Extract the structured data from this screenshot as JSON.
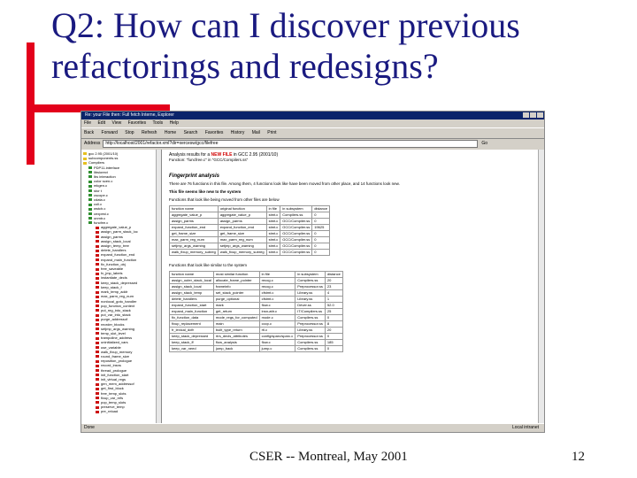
{
  "slide": {
    "title": "Q2: How can I discover previous refactorings and redesigns?",
    "footer_center": "CSER -- Montreal, May 2001",
    "page_number": "12",
    "accent_color": "#e3001b",
    "title_color": "#1a1a80"
  },
  "browser": {
    "window_title": "Re: your File then: Full fetch Interne, Explorer",
    "menu": [
      "File",
      "Edit",
      "View",
      "Favorites",
      "Tools",
      "Help"
    ],
    "toolbar": [
      "Back",
      "Forward",
      "Stop",
      "Refresh",
      "Home",
      "Search",
      "Favorites",
      "History",
      "Mail",
      "Print"
    ],
    "address_label": "Address",
    "address_value": "http://localhost/2001/refactor.xml?dir=xercesw/gcc/filefree",
    "go_label": "Go",
    "status_left": "Done",
    "status_right": "Local intranet"
  },
  "tree": {
    "items": [
      {
        "label": "gcc 2.95 (2001/10)",
        "color": "y"
      },
      {
        "label": "subcomponents.ss",
        "color": "y"
      },
      {
        "label": "Compilers",
        "color": "y"
      },
      {
        "label": "PDP11-interface",
        "color": "g"
      },
      {
        "label": "libsiorect",
        "color": "g"
      },
      {
        "label": "lbs interaction",
        "color": "g"
      },
      {
        "label": "color scen.c",
        "color": "g"
      },
      {
        "label": "mkgen.c",
        "color": "g"
      },
      {
        "label": "stor t",
        "color": "g"
      },
      {
        "label": "cscope.c",
        "color": "g"
      },
      {
        "label": "cdata.c",
        "color": "g"
      },
      {
        "label": "coll.c",
        "color": "g"
      },
      {
        "label": "wstch.c",
        "color": "g"
      },
      {
        "label": "cexpest.c",
        "color": "g"
      },
      {
        "label": "onmtr.c",
        "color": "g"
      },
      {
        "label": "funcfee.c",
        "color": "g"
      },
      {
        "label": "aggregate_value_p",
        "color": "r"
      },
      {
        "label": "assign_parm_stack_loc",
        "color": "r"
      },
      {
        "label": "assign_parms",
        "color": "r"
      },
      {
        "label": "assign_stack_local",
        "color": "r"
      },
      {
        "label": "assign_temp_tree",
        "color": "r"
      },
      {
        "label": "delete_handlers",
        "color": "r"
      },
      {
        "label": "expand_function_end",
        "color": "r"
      },
      {
        "label": "expand_main_function",
        "color": "r"
      },
      {
        "label": "fix_function_obj",
        "color": "r"
      },
      {
        "label": "free_saveable",
        "color": "r"
      },
      {
        "label": "fx_jmp_labels",
        "color": "r"
      },
      {
        "label": "instantiate_decls",
        "color": "r"
      },
      {
        "label": "keep_stack_depressed",
        "color": "r"
      },
      {
        "label": "keep_stack_f",
        "color": "r"
      },
      {
        "label": "mark_temp_addr",
        "color": "r"
      },
      {
        "label": "max_parm_reg_num",
        "color": "r"
      },
      {
        "label": "nonlocal_goto_handler",
        "color": "r"
      },
      {
        "label": "pop_function_context",
        "color": "r"
      },
      {
        "label": "put_reg_into_stack",
        "color": "r"
      },
      {
        "label": "put_var_into_stack",
        "color": "r"
      },
      {
        "label": "purge_addressof",
        "color": "r"
      },
      {
        "label": "reorder_blocks",
        "color": "r"
      },
      {
        "label": "setjmp_args_warning",
        "color": "r"
      },
      {
        "label": "temp_slot_level",
        "color": "r"
      },
      {
        "label": "trampoline_address",
        "color": "r"
      },
      {
        "label": "uninitialized_vars",
        "color": "r"
      },
      {
        "label": "use_variable",
        "color": "r"
      },
      {
        "label": "walk_fixup_memory",
        "color": "r"
      },
      {
        "label": "round_frame_size",
        "color": "r"
      },
      {
        "label": "reposition_prologue",
        "color": "r"
      },
      {
        "label": "record_insns",
        "color": "r"
      },
      {
        "label": "thread_prologue",
        "color": "r"
      },
      {
        "label": "init_function_start",
        "color": "r"
      },
      {
        "label": "init_virtual_regs",
        "color": "r"
      },
      {
        "label": "gen_mem_addressof",
        "color": "r"
      },
      {
        "label": "get_first_block",
        "color": "r"
      },
      {
        "label": "free_temp_slots",
        "color": "r"
      },
      {
        "label": "fixup_var_refs",
        "color": "r"
      },
      {
        "label": "pop_temp_slots",
        "color": "r"
      },
      {
        "label": "preserve_temp",
        "color": "r"
      },
      {
        "label": "pre_reload",
        "color": "r"
      }
    ]
  },
  "page": {
    "heading_prefix": "Analysis results for a ",
    "heading_highlight": "NEW FILE",
    "heading_suffix": " in GCC 2.95 (2001/10)",
    "subheading": "Function: \"funcfree.c\" in \"GCC/Compilers.ss\"",
    "analysis_title": "Fingerprint analysis",
    "desc_line": "There are 76 functions in this file. Among them, 4 functions look like have been moved from other place, and 14 functions look new.",
    "new_functions_title": "This file seems like new to the system",
    "moved_intro": "Functions that look like being moved from other files are below",
    "table1": {
      "headers": [
        "function name",
        "original function",
        "in file",
        "in subsystem",
        "distance"
      ],
      "rows": [
        [
          "aggregate_value_p",
          "aggregate_value_p",
          "stmt.c",
          "Compilers.ss",
          "0"
        ],
        [
          "assign_parms",
          "assign_parms",
          "stmt.c",
          "GCC/Compiler.ss",
          "0"
        ],
        [
          "expand_function_end",
          "expand_function_end",
          "stmt.c",
          "GCC/Compiler.ss",
          "19625"
        ],
        [
          "get_frame_size",
          "get_frame_size",
          "stmt.c",
          "GCC/Compiler.ss",
          "0"
        ],
        [
          "max_parm_reg_num",
          "max_parm_reg_num",
          "stmt.c",
          "GCC/Compiler.ss",
          "0"
        ],
        [
          "setjmp_args_warning",
          "setjmp_args_warning",
          "stmt.c",
          "GCC/Compiler.ss",
          "0"
        ],
        [
          "walk_fixup_memory_subreg",
          "walk_fixup_memory_subreg",
          "stmt.c",
          "GCC/Compiler.ss",
          "0"
        ]
      ]
    },
    "similar_intro": "Functions that look like similar to the system",
    "table2": {
      "headers": [
        "function name",
        "most similar function",
        "in file",
        "in subsystem",
        "distance"
      ],
      "rows": [
        [
          "assign_outer_stack_local",
          "allocate_frame_pointer",
          "recog.c",
          "Compilers.ss",
          "20"
        ],
        [
          "assign_stack_local",
          "frameinfo",
          "recog.c",
          "Preprocessor.ss",
          "23"
        ],
        [
          "assign_stack_temp",
          "set_stack_pointer",
          "cfstmt.c",
          "Library.ss",
          "4"
        ],
        [
          "delete_handlers",
          "purge_optional",
          "cfstmt.c",
          "Library.ss",
          "1"
        ],
        [
          "expand_function_start",
          "mark",
          "flow.c",
          "Driver.ss",
          "52.0"
        ],
        [
          "expand_main_function",
          "get_return",
          "insn-attr.c",
          "IT/Compilers.ss",
          "25"
        ],
        [
          "fix_function_data",
          "mode_regs_for_computed",
          "mode.c",
          "Compilers.ss",
          "0"
        ],
        [
          "fixup_replacement",
          "main",
          "cccp.c",
          "Preprocessor.ss",
          "8"
        ],
        [
          "fr_lexical_ddfr",
          "built_type_return",
          "rtl.c",
          "Library.ss",
          "20"
        ],
        [
          "keep_stack_depressed",
          "rtrs_decls_attributes",
          "config/sparc/sparc.c",
          "Preprocessor.ss",
          "0"
        ],
        [
          "keep_stack_ff",
          "flow_analysis",
          "flow.c",
          "Compilers.ss",
          "185"
        ],
        [
          "keep_var_need",
          "jump_back",
          "jump.c",
          "Compilers.ss",
          "0"
        ]
      ]
    }
  }
}
